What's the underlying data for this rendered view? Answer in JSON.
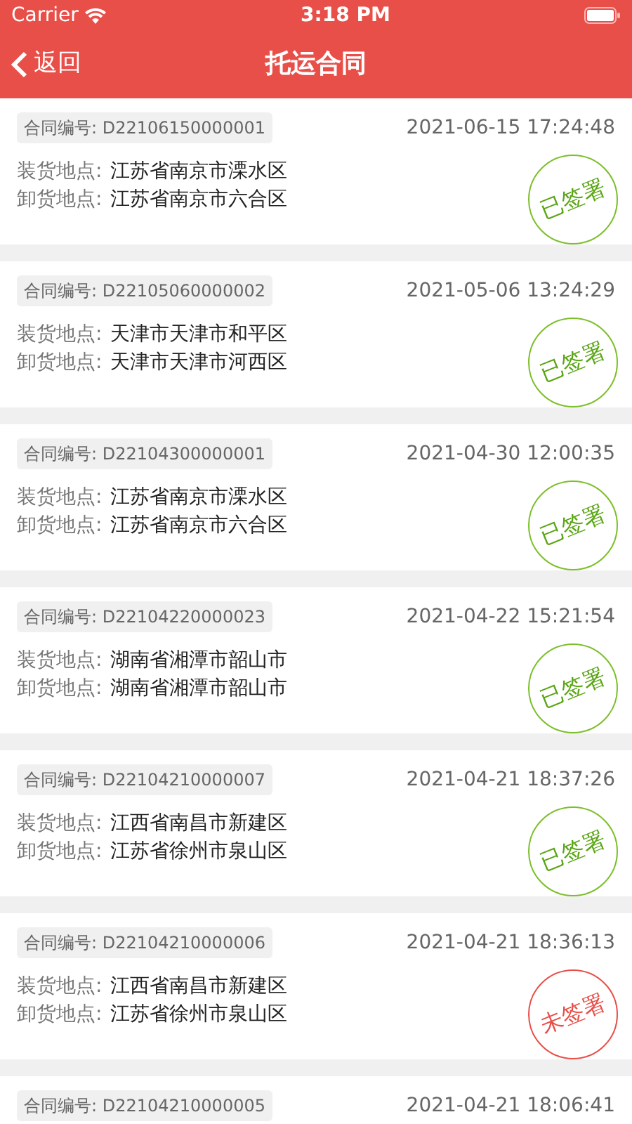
{
  "status_bar": {
    "carrier": "Carrier",
    "time": "3:18 PM"
  },
  "nav": {
    "back": "返回",
    "title": "托运合同"
  },
  "contracts": [
    {
      "number": "合同编号: D22106150000001",
      "time": "2021-06-15 17:24:48",
      "load_label": "装货地点:",
      "load": "江苏省南京市溧水区",
      "unload_label": "卸货地点:",
      "unload": "江苏省南京市六合区",
      "signed": true,
      "stamp": "已签署"
    },
    {
      "number": "合同编号: D22105060000002",
      "time": "2021-05-06 13:24:29",
      "load_label": "装货地点:",
      "load": "天津市天津市和平区",
      "unload_label": "卸货地点:",
      "unload": "天津市天津市河西区",
      "signed": true,
      "stamp": "已签署"
    },
    {
      "number": "合同编号: D22104300000001",
      "time": "2021-04-30 12:00:35",
      "load_label": "装货地点:",
      "load": "江苏省南京市溧水区",
      "unload_label": "卸货地点:",
      "unload": "江苏省南京市六合区",
      "signed": true,
      "stamp": "已签署"
    },
    {
      "number": "合同编号: D22104220000023",
      "time": "2021-04-22 15:21:54",
      "load_label": "装货地点:",
      "load": "湖南省湘潭市韶山市",
      "unload_label": "卸货地点:",
      "unload": "湖南省湘潭市韶山市",
      "signed": true,
      "stamp": "已签署"
    },
    {
      "number": "合同编号: D22104210000007",
      "time": "2021-04-21 18:37:26",
      "load_label": "装货地点:",
      "load": "江西省南昌市新建区",
      "unload_label": "卸货地点:",
      "unload": "江苏省徐州市泉山区",
      "signed": true,
      "stamp": "已签署"
    },
    {
      "number": "合同编号: D22104210000006",
      "time": "2021-04-21 18:36:13",
      "load_label": "装货地点:",
      "load": "江西省南昌市新建区",
      "unload_label": "卸货地点:",
      "unload": "江苏省徐州市泉山区",
      "signed": false,
      "stamp": "未签署"
    },
    {
      "number": "合同编号: D22104210000005",
      "time": "2021-04-21 18:06:41"
    }
  ]
}
